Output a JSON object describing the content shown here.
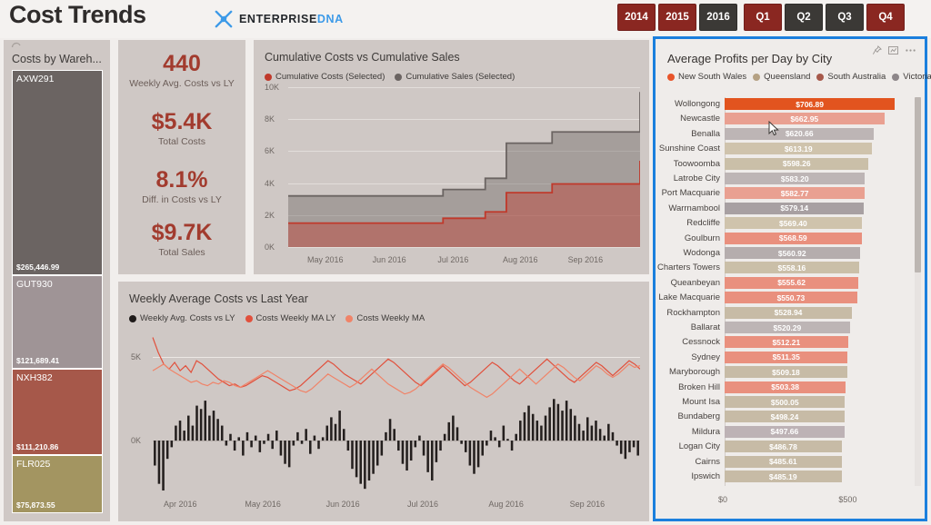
{
  "header": {
    "title": "Cost Trends",
    "brand": {
      "part1": "ENTERPRISE",
      "part2": "DNA",
      "icon": "dna-helix-icon",
      "color": "#3c9ae8"
    },
    "year_slicer": [
      {
        "label": "2014",
        "selected": false
      },
      {
        "label": "2015",
        "selected": false
      },
      {
        "label": "2016",
        "selected": true
      }
    ],
    "quarter_slicer": [
      {
        "label": "Q1",
        "selected": false
      },
      {
        "label": "Q2",
        "selected": true
      },
      {
        "label": "Q3",
        "selected": true
      },
      {
        "label": "Q4",
        "selected": false
      }
    ],
    "colors": {
      "unselected": "#8a2721",
      "selected": "#3b3936"
    }
  },
  "treemap": {
    "title": "Costs by Wareh...",
    "chart_data": {
      "type": "treemap",
      "title": "Costs by Warehouse",
      "categories": [
        "AXW291",
        "GUT930",
        "NXH382",
        "FLR025"
      ],
      "values": [
        265446.99,
        121689.41,
        111210.86,
        75873.55
      ],
      "value_labels": [
        "$265,446.99",
        "$121,689.41",
        "$111,210.86",
        "$75,873.55"
      ],
      "colors": [
        "#6b6462",
        "#9f9496",
        "#a6584a",
        "#a39561"
      ]
    }
  },
  "kpis": [
    {
      "value": "440",
      "label": "Weekly Avg. Costs vs LY"
    },
    {
      "value": "$5.4K",
      "label": "Total Costs"
    },
    {
      "value": "8.1%",
      "label": "Diff. in Costs vs LY"
    },
    {
      "value": "$9.7K",
      "label": "Total Sales"
    }
  ],
  "cumulative": {
    "title": "Cumulative Costs vs Cumulative Sales",
    "legend": [
      {
        "label": "Cumulative Costs (Selected)",
        "color": "#c0392b"
      },
      {
        "label": "Cumulative Sales (Selected)",
        "color": "#6b6462"
      }
    ],
    "chart_data": {
      "type": "area",
      "title": "Cumulative Costs vs Cumulative Sales",
      "xlabel": "",
      "ylabel": "",
      "ylim": [
        0,
        10000
      ],
      "yticks": [
        "0K",
        "2K",
        "4K",
        "6K",
        "8K",
        "10K"
      ],
      "ytick_values": [
        0,
        2000,
        4000,
        6000,
        8000,
        10000
      ],
      "xticks": [
        "May 2016",
        "Jun 2016",
        "Jul 2016",
        "Aug 2016",
        "Sep 2016"
      ],
      "grid": true,
      "legend_position": "top",
      "step": true,
      "series": [
        {
          "name": "Cumulative Sales (Selected)",
          "color": "#6b6462",
          "x": [
            0,
            0.3,
            0.44,
            0.56,
            0.62,
            0.75,
            1.0
          ],
          "values": [
            3200,
            3200,
            3600,
            4300,
            6500,
            7200,
            9700
          ]
        },
        {
          "name": "Cumulative Costs (Selected)",
          "color": "#c0392b",
          "x": [
            0,
            0.3,
            0.44,
            0.56,
            0.62,
            0.75,
            1.0
          ],
          "values": [
            1500,
            1500,
            1800,
            2200,
            3400,
            3950,
            5400
          ]
        }
      ]
    }
  },
  "weekly": {
    "title": "Weekly Average Costs vs Last Year",
    "legend": [
      {
        "label": "Weekly Avg. Costs vs LY",
        "color": "#1f1b1a"
      },
      {
        "label": "Costs Weekly MA LY",
        "color": "#e1503c"
      },
      {
        "label": "Costs Weekly MA",
        "color": "#f08368"
      }
    ],
    "chart_data": {
      "type": "bar",
      "title": "Weekly Average Costs vs Last Year",
      "xlabel": "",
      "ylabel": "",
      "yticks": [
        "0K",
        "5K"
      ],
      "ytick_values": [
        0,
        5000
      ],
      "ylim": [
        -3000,
        6500
      ],
      "xticks": [
        "Apr 2016",
        "May 2016",
        "Jun 2016",
        "Jul 2016",
        "Aug 2016",
        "Sep 2016"
      ],
      "grid": true,
      "legend_position": "top",
      "bars": [
        -1500,
        -2600,
        -3000,
        -1100,
        -400,
        900,
        1200,
        600,
        1500,
        900,
        2100,
        1900,
        2400,
        1500,
        1800,
        1300,
        900,
        -300,
        400,
        -600,
        200,
        -900,
        500,
        -400,
        300,
        -700,
        -200,
        400,
        -500,
        600,
        -900,
        -1400,
        -1600,
        -300,
        500,
        -200,
        700,
        -800,
        300,
        -500,
        200,
        900,
        1400,
        1000,
        1800,
        700,
        -600,
        -1700,
        -2200,
        -2600,
        -2900,
        -2400,
        -2000,
        -1500,
        -900,
        500,
        1300,
        700,
        -600,
        -1400,
        -1800,
        -1200,
        -400,
        300,
        -900,
        -1900,
        -2400,
        -1300,
        -600,
        400,
        1100,
        1500,
        800,
        -200,
        -700,
        -1500,
        -2000,
        -1600,
        -900,
        -300,
        600,
        200,
        -400,
        900,
        100,
        -600,
        400,
        1200,
        1700,
        2100,
        1600,
        1200,
        900,
        1500,
        2000,
        2500,
        2200,
        1800,
        2400,
        1900,
        1500,
        1000,
        600,
        1400,
        900,
        1200,
        700,
        300,
        1000,
        500,
        -300,
        -800,
        -1100,
        -700,
        -400,
        -900
      ],
      "series_lines": [
        {
          "name": "Costs Weekly MA LY",
          "color": "#e1503c",
          "values": [
            6200,
            5300,
            4600,
            4300,
            4700,
            4200,
            4500,
            4100,
            4800,
            4600,
            4300,
            4000,
            3700,
            3500,
            3300,
            3400,
            3200,
            3300,
            3500,
            3700,
            3900,
            3800,
            3600,
            3400,
            3200,
            3000,
            3100,
            3300,
            3600,
            3900,
            4200,
            4500,
            4800,
            4600,
            4300,
            4000,
            3800,
            3600,
            3400,
            3700,
            4000,
            4300,
            4600,
            4900,
            4700,
            4400,
            4100,
            3800,
            3500,
            3300,
            3600,
            3900,
            4200,
            4500,
            4200,
            3900,
            3600,
            3300,
            3500,
            3800,
            4100,
            4400,
            4700,
            4500,
            4200,
            3900,
            3600,
            3400,
            3700,
            4000,
            4300,
            4600,
            4900,
            4600,
            4300,
            4000,
            3700,
            3500,
            3800,
            4100,
            4400,
            4700,
            4500,
            4200,
            3900,
            4200,
            4500,
            4800,
            4600,
            4300
          ]
        },
        {
          "name": "Costs Weekly MA",
          "color": "#f08368",
          "values": [
            4200,
            4400,
            4600,
            4300,
            4100,
            3900,
            3700,
            3500,
            3600,
            3400,
            3300,
            3500,
            3400,
            3600,
            3500,
            3300,
            3200,
            3400,
            3600,
            3800,
            4000,
            4200,
            4000,
            3800,
            3600,
            3400,
            3200,
            3000,
            2900,
            3100,
            3400,
            3700,
            4000,
            3800,
            3600,
            3400,
            3200,
            3400,
            3700,
            4000,
            4300,
            4000,
            3700,
            3400,
            3200,
            3000,
            2800,
            2900,
            3100,
            3400,
            3700,
            4000,
            4300,
            4600,
            4400,
            4100,
            3800,
            3500,
            3200,
            3000,
            2800,
            2600,
            2800,
            3100,
            3400,
            3700,
            4000,
            4300,
            4000,
            3700,
            3400,
            3700,
            4000,
            4300,
            4600,
            4400,
            4100,
            3800,
            3600,
            3900,
            4200,
            4500,
            4300,
            4000,
            3800,
            4000,
            4300,
            4600,
            4400,
            4500
          ]
        }
      ]
    }
  },
  "city_panel": {
    "title": "Average Profits per Day by City",
    "icons": [
      "pin-icon",
      "focus-mode-icon",
      "more-options-icon"
    ],
    "legend": [
      {
        "label": "New South Wales",
        "color": "#e8542a"
      },
      {
        "label": "Queensland",
        "color": "#b5a183"
      },
      {
        "label": "South Australia",
        "color": "#a6584a"
      },
      {
        "label": "Victoria",
        "color": "#8d8689"
      }
    ],
    "chart_data": {
      "type": "bar",
      "orientation": "horizontal",
      "title": "Average Profits per Day by City",
      "xlabel": "",
      "ylabel": "",
      "xlim": [
        0,
        500
      ],
      "xticks": [
        "$0",
        "$500"
      ],
      "xtick_values": [
        0,
        500
      ],
      "grid": false,
      "legend_position": "top",
      "categories": [
        "Wollongong",
        "Newcastle",
        "Benalla",
        "Sunshine Coast",
        "Toowoomba",
        "Latrobe City",
        "Port Macquarie",
        "Warrnambool",
        "Redcliffe",
        "Goulburn",
        "Wodonga",
        "Charters Towers",
        "Queanbeyan",
        "Lake Macquarie",
        "Rockhampton",
        "Ballarat",
        "Cessnock",
        "Sydney",
        "Maryborough",
        "Broken Hill",
        "Mount Isa",
        "Bundaberg",
        "Mildura",
        "Logan City",
        "Cairns",
        "Ipswich"
      ],
      "values": [
        706.89,
        662.95,
        620.66,
        613.19,
        598.26,
        583.2,
        582.77,
        579.14,
        569.4,
        568.59,
        560.92,
        558.16,
        555.62,
        550.73,
        528.94,
        520.29,
        512.21,
        511.35,
        509.18,
        503.38,
        500.05,
        498.24,
        497.66,
        486.78,
        485.61,
        485.19
      ],
      "value_labels": [
        "$706.89",
        "$662.95",
        "$620.66",
        "$613.19",
        "$598.26",
        "$583.20",
        "$582.77",
        "$579.14",
        "$569.40",
        "$568.59",
        "$560.92",
        "$558.16",
        "$555.62",
        "$550.73",
        "$528.94",
        "$520.29",
        "$512.21",
        "$511.35",
        "$509.18",
        "$503.38",
        "$500.05",
        "$498.24",
        "$497.66",
        "$486.78",
        "$485.61",
        "$485.19"
      ],
      "bar_colors": [
        "#e2541f",
        "#e9a091",
        "#bdb5b5",
        "#cfc3ac",
        "#cabfa8",
        "#bdb5b5",
        "#e9a091",
        "#a8a0a2",
        "#cfc3ac",
        "#e9907e",
        "#b5adad",
        "#cabfa8",
        "#e9907e",
        "#e9907e",
        "#c7bba6",
        "#bdb5b5",
        "#e9907e",
        "#e9907e",
        "#c7bba6",
        "#e9907e",
        "#c7bba6",
        "#c7bba6",
        "#bdb2b5",
        "#c7bba6",
        "#c7bba6",
        "#c7bba6"
      ],
      "highlighted": "Wollongong"
    },
    "scrollbar": {
      "visible": true,
      "position_pct": 0,
      "thumb_pct": 45
    }
  }
}
